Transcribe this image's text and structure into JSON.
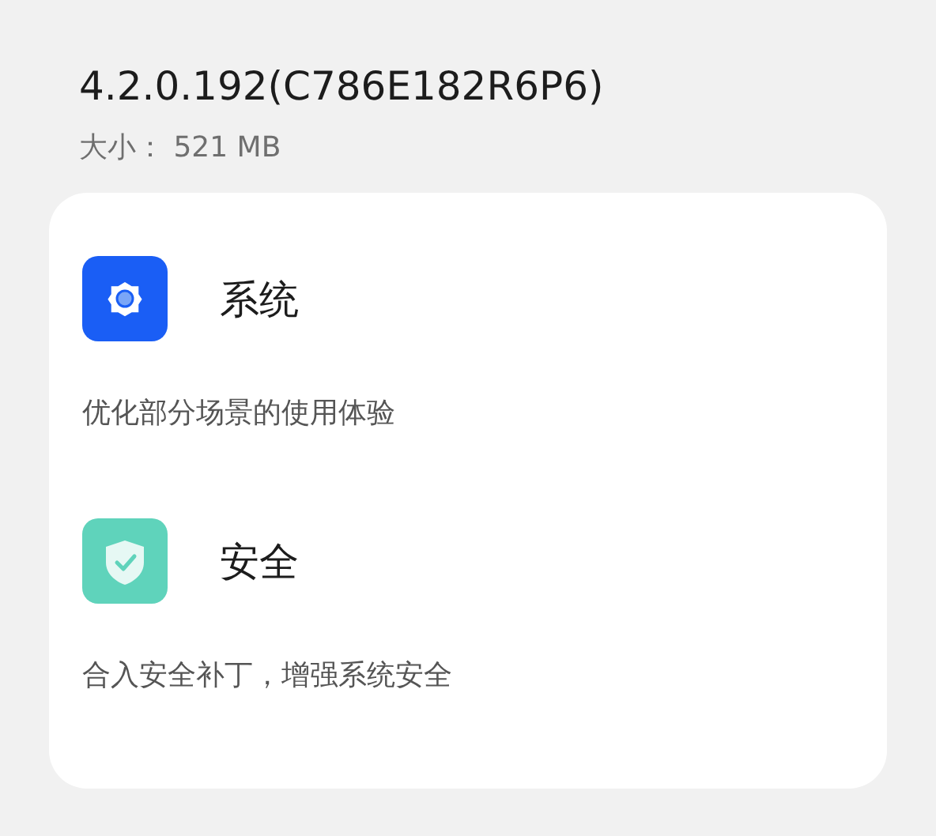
{
  "version": "4.2.0.192(C786E182R6P6)",
  "size": "大小： 521 MB",
  "sections": [
    {
      "kind": "system",
      "title": "系统",
      "description": "优化部分场景的使用体验"
    },
    {
      "kind": "security",
      "title": "安全",
      "description": "合入安全补丁，增强系统安全"
    }
  ]
}
